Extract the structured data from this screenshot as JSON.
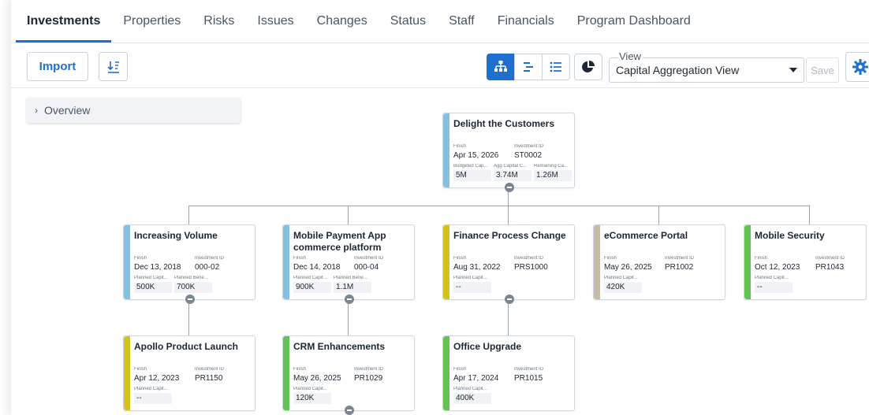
{
  "tabs": [
    {
      "label": "Investments"
    },
    {
      "label": "Properties"
    },
    {
      "label": "Risks"
    },
    {
      "label": "Issues"
    },
    {
      "label": "Changes"
    },
    {
      "label": "Status"
    },
    {
      "label": "Staff"
    },
    {
      "label": "Financials"
    },
    {
      "label": "Program Dashboard"
    }
  ],
  "toolbar": {
    "import_label": "Import",
    "view_label": "View",
    "view_value": "Capital Aggregation View",
    "save_label": "Save"
  },
  "overview": {
    "label": "Overview"
  },
  "colors": {
    "accent": "#1f6fd1",
    "bar_blue": "#86c0e0",
    "bar_yellow": "#d2c31a",
    "bar_tan": "#c7bba6",
    "bar_green": "#62c353"
  },
  "cards": {
    "root": {
      "title": "Delight the Customers",
      "finish_label": "Finish",
      "finish": "Apr 15, 2026",
      "id_label": "Investment ID",
      "id": "ST0002",
      "m1_label": "Budgeted Cap...",
      "m1": "5M",
      "m2_label": "Agg Capital C...",
      "m2": "3.74M",
      "m3_label": "Remaining Ca...",
      "m3": "1.26M"
    },
    "c1": {
      "title": "Increasing Volume",
      "finish_label": "Finish",
      "finish": "Dec 13, 2018",
      "id_label": "Investment ID",
      "id": "000-02",
      "m1_label": "Planned Capit...",
      "m1": "500K",
      "m2_label": "Planned Bene...",
      "m2": "700K"
    },
    "c2": {
      "title": "Mobile Payment App commerce platform",
      "finish_label": "Finish",
      "finish": "Dec 14, 2018",
      "id_label": "Investment ID",
      "id": "000-04",
      "m1_label": "Planned Capit...",
      "m1": "900K",
      "m2_label": "Planned Bene...",
      "m2": "1.1M"
    },
    "c3": {
      "title": "Finance Process Change",
      "finish_label": "Finish",
      "finish": "Aug 31, 2022",
      "id_label": "Investment ID",
      "id": "PRS1000",
      "m1_label": "Planned Capit...",
      "m1": "--"
    },
    "c4": {
      "title": "eCommerce Portal",
      "finish_label": "Finish",
      "finish": "May 26, 2025",
      "id_label": "Investment ID",
      "id": "PR1002",
      "m1_label": "Planned Capit...",
      "m1": "420K"
    },
    "c5": {
      "title": "Mobile Security",
      "finish_label": "Finish",
      "finish": "Oct 12, 2023",
      "id_label": "Investment ID",
      "id": "PR1043",
      "m1_label": "Planned Capit...",
      "m1": "--"
    },
    "g1": {
      "title": "Apollo Product Launch",
      "finish_label": "Finish",
      "finish": "Apr 12, 2023",
      "id_label": "Investment ID",
      "id": "PR1150",
      "m1_label": "Planned Capit...",
      "m1": "--"
    },
    "g2": {
      "title": "CRM Enhancements",
      "finish_label": "Finish",
      "finish": "May 26, 2025",
      "id_label": "Investment ID",
      "id": "PR1029",
      "m1_label": "Planned Capit...",
      "m1": "120K"
    },
    "g3": {
      "title": "Office Upgrade",
      "finish_label": "Finish",
      "finish": "Apr 17, 2024",
      "id_label": "Investment ID",
      "id": "PR1015",
      "m1_label": "Planned Capit...",
      "m1": "400K"
    }
  }
}
